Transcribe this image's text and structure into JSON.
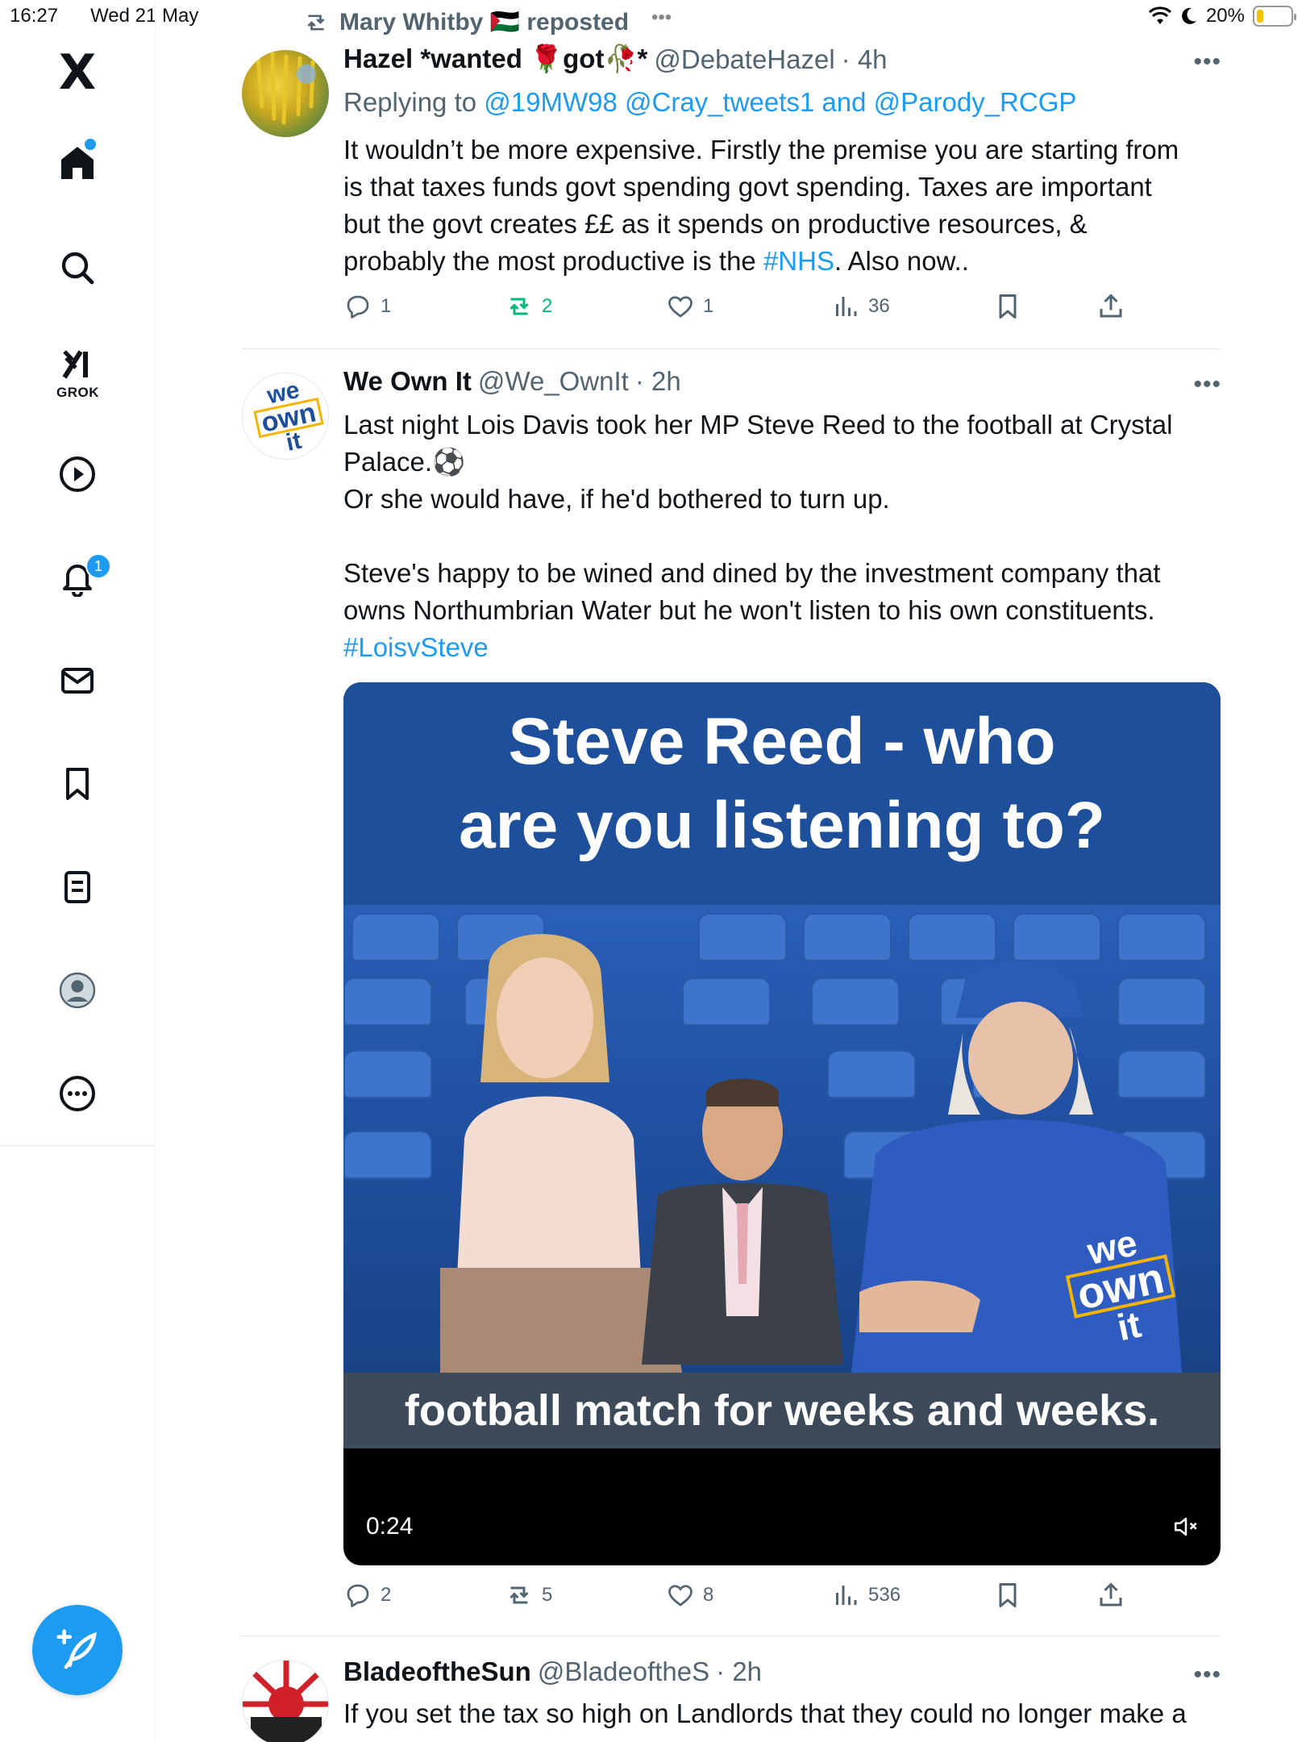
{
  "status_bar": {
    "time": "16:27",
    "date": "Wed 21 May",
    "battery": "20%",
    "battery_level": 0.2
  },
  "sidebar": {
    "logo": "X",
    "grok_label": "GROK",
    "notifications_badge": "1",
    "icons": [
      "x-logo-icon",
      "home-icon",
      "search-icon",
      "grok-icon",
      "play-icon",
      "bell-icon",
      "mail-icon",
      "bookmark-icon",
      "list-icon",
      "profile-icon",
      "more-icon",
      "compose-icon"
    ]
  },
  "feed": {
    "repost_banner": {
      "user": "Mary Whitby 🇵🇸 reposted"
    },
    "tweets": [
      {
        "name": "Hazel *wanted 🌹got🥀*",
        "handle": "@DebateHazel",
        "time": "· 4h",
        "replying_prefix": "Replying to",
        "replying_to": "@19MW98 @Cray_tweets1 and @Parody_RCGP",
        "text_lines": [
          "It wouldn’t be more expensive.  Firstly the premise you are starting from",
          "is that taxes funds govt spending govt spending.  Taxes are important",
          "but the govt creates ££ as it spends on productive resources, &",
          "probably the most productive is the"
        ],
        "hashtag": "#NHS",
        "text_tail": ".  Also now..",
        "replies": "1",
        "reposts": "2",
        "likes": "1",
        "views": "36"
      },
      {
        "name": "We Own It",
        "handle": "@We_OwnIt",
        "time": "· 2h",
        "text_lines": [
          "Last night Lois Davis took her MP Steve Reed to the football at Crystal",
          "Palace.⚽",
          "Or she would have, if he'd bothered to turn up.",
          "",
          "Steve's happy to be wined and dined by the investment company that",
          "owns Northumbrian Water but he won't listen to his own constituents."
        ],
        "hashtag": "#LoisvSteve",
        "video": {
          "title_line1": "Steve Reed - who",
          "title_line2": "are you listening to?",
          "caption": "football match for weeks and weeks.",
          "duration": "0:24",
          "logo_line1": "we",
          "logo_line2": "own",
          "logo_line3": "it"
        },
        "replies": "2",
        "reposts": "5",
        "likes": "8",
        "views": "536"
      },
      {
        "name": "BladeoftheSun",
        "handle": "@BladeoftheS",
        "time": "· 2h",
        "text": "If you set the tax so high on Landlords that they could no longer make a"
      }
    ]
  },
  "avatar_logo": {
    "line1": "we",
    "line2": "own",
    "line3": "it"
  },
  "colors": {
    "accent": "#1d9bf0",
    "repost_green": "#00ba7c",
    "muted": "#536471",
    "video_blue": "#1e4f9a"
  }
}
